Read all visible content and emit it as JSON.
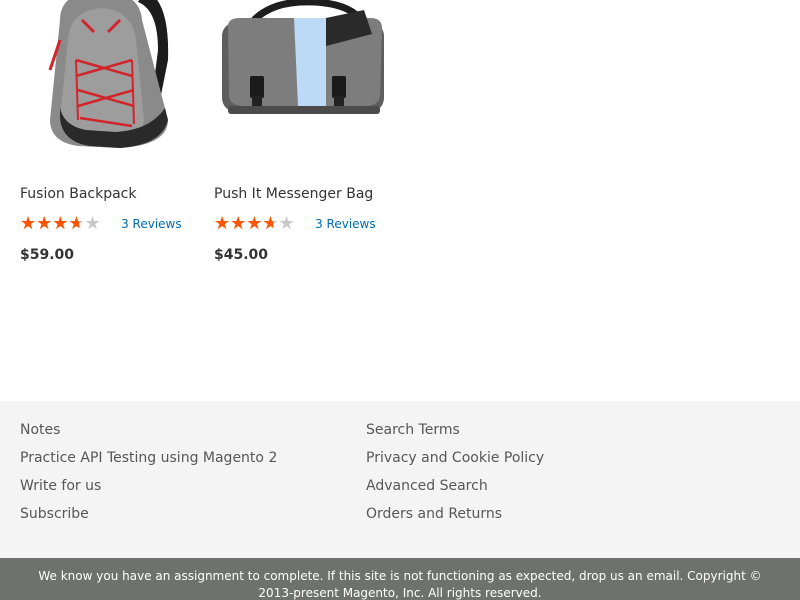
{
  "products": [
    {
      "name": "Fusion Backpack",
      "rating_fraction": 0.65,
      "reviews": "3 Reviews",
      "price": "$59.00",
      "image": "backpack-image"
    },
    {
      "name": "Push It Messenger Bag",
      "rating_fraction": 0.65,
      "reviews": "3 Reviews",
      "price": "$45.00",
      "image": "messenger-bag-image"
    }
  ],
  "footer": {
    "col1": [
      "Notes",
      "Practice API Testing using Magento 2",
      "Write for us",
      "Subscribe"
    ],
    "col2": [
      "Search Terms",
      "Privacy and Cookie Policy",
      "Advanced Search",
      "Orders and Returns"
    ]
  },
  "copyright": "We know you have an assignment to complete. If this site is not functioning as expected, drop us an email. Copyright © 2013-present Magento, Inc. All rights reserved.",
  "colors": {
    "star_filled": "#ff5501",
    "star_empty": "#c7c7c7",
    "link": "#006bb4",
    "footer_bg": "#f4f4f4",
    "copyright_bg": "#6e716e"
  }
}
